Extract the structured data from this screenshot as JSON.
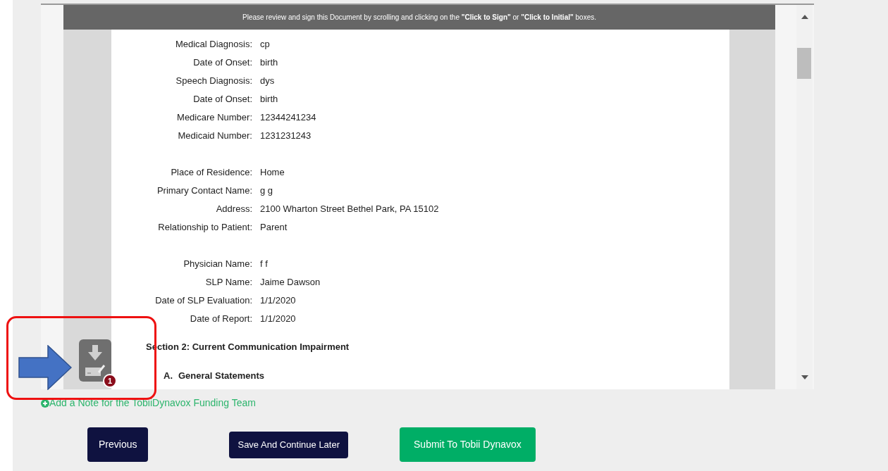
{
  "viewer": {
    "banner": "Please review and sign this Document by scrolling and clicking on the **\"Click to Sign\"** or **\"Click to Initial\"** boxes.",
    "field_groups": [
      [
        {
          "label": "Medical Diagnosis:",
          "value": "cp"
        },
        {
          "label": "Date of Onset:",
          "value": "birth"
        },
        {
          "label": "Speech Diagnosis:",
          "value": "dys"
        },
        {
          "label": "Date of Onset:",
          "value": "birth"
        },
        {
          "label": "Medicare Number:",
          "value": "12344241234"
        },
        {
          "label": "Medicaid Number:",
          "value": "1231231243"
        }
      ],
      [
        {
          "label": "Place of Residence:",
          "value": "Home"
        },
        {
          "label": "Primary Contact Name:",
          "value": "g g"
        },
        {
          "label": "Address:",
          "value": "2100 Wharton Street Bethel Park, PA 15102"
        },
        {
          "label": "Relationship to Patient:",
          "value": "Parent"
        }
      ],
      [
        {
          "label": "Physician Name:",
          "value": "f f"
        },
        {
          "label": "SLP Name:",
          "value": "Jaime Dawson"
        },
        {
          "label": "Date of SLP Evaluation:",
          "value": "1/1/2020"
        },
        {
          "label": "Date of Report:",
          "value": "1/1/2020"
        }
      ]
    ],
    "section_heading": "Section 2: Current Communication Impairment",
    "subheading": {
      "marker": "A.",
      "text": "General Statements"
    },
    "sign_badge": "1"
  },
  "note_link": "Add a Note for the TobiiDynavox Funding Team",
  "buttons": [
    {
      "label": "Previous",
      "kind": "dark"
    },
    {
      "label": "Save And Continue Later",
      "kind": "dark_small"
    },
    {
      "label": "Submit To Tobii Dynavox",
      "kind": "green"
    }
  ]
}
